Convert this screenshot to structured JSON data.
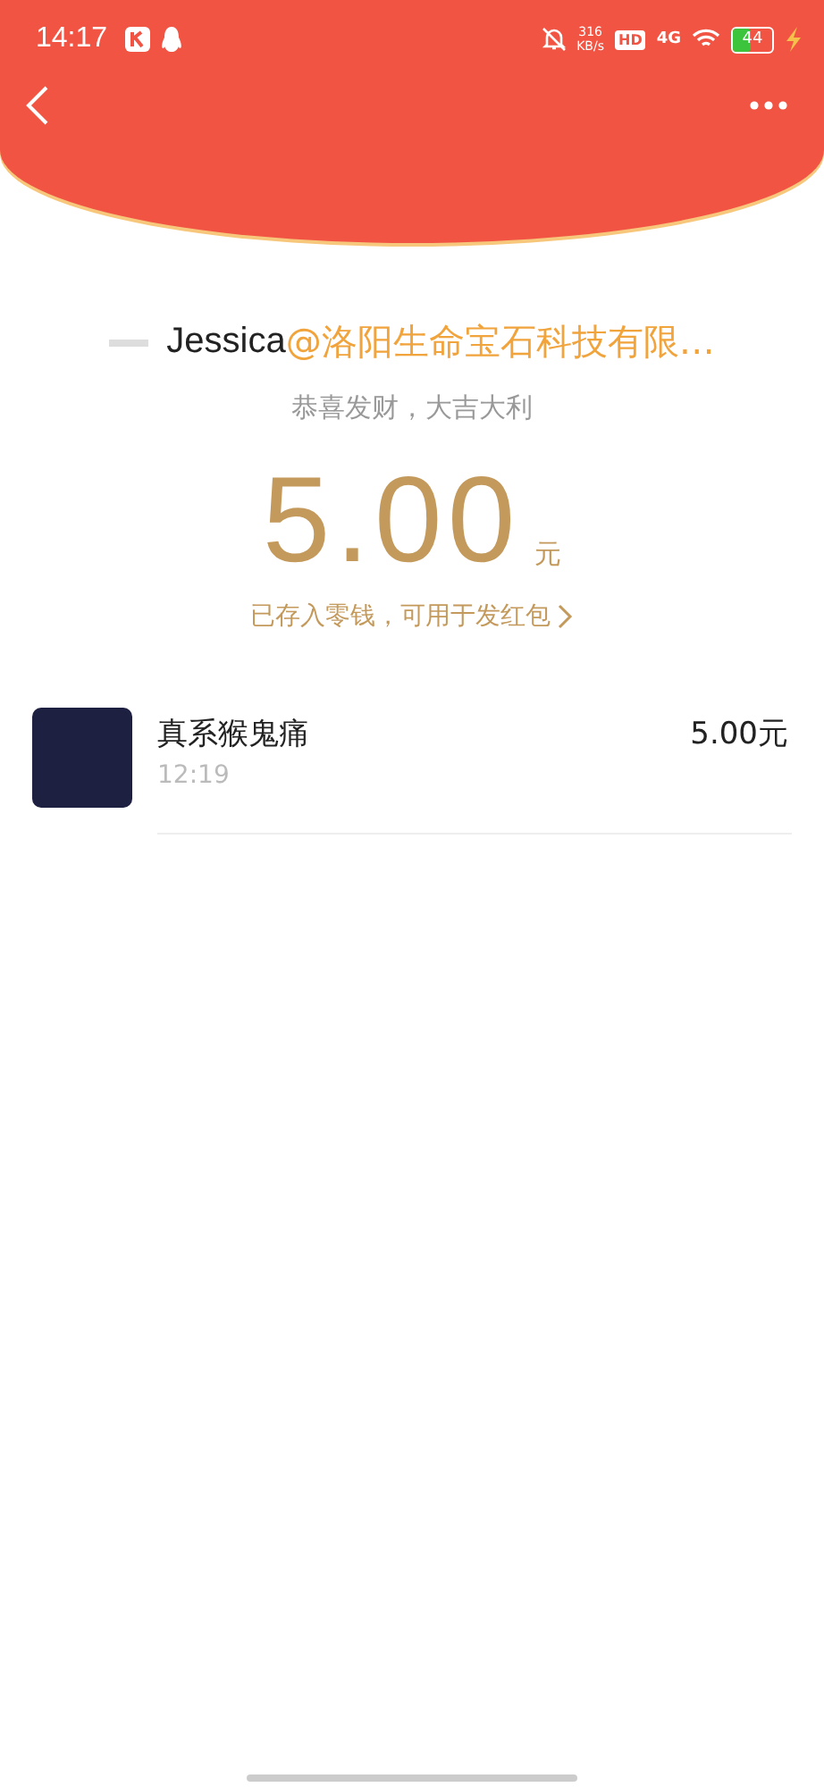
{
  "status_bar": {
    "time": "14:17",
    "speed_value": "316",
    "speed_unit": "KB/s",
    "hd": "HD",
    "network": "4G",
    "battery": "44"
  },
  "sender": {
    "name": "Jessica",
    "company": "@洛阳生命宝石科技有限…"
  },
  "greeting": "恭喜发财，大吉大利",
  "amount": {
    "value": "5.00",
    "unit": "元"
  },
  "note": "已存入零钱，可用于发红包",
  "records": [
    {
      "name": "真系猴鬼痛",
      "time": "12:19",
      "amount": "5.00元"
    }
  ]
}
